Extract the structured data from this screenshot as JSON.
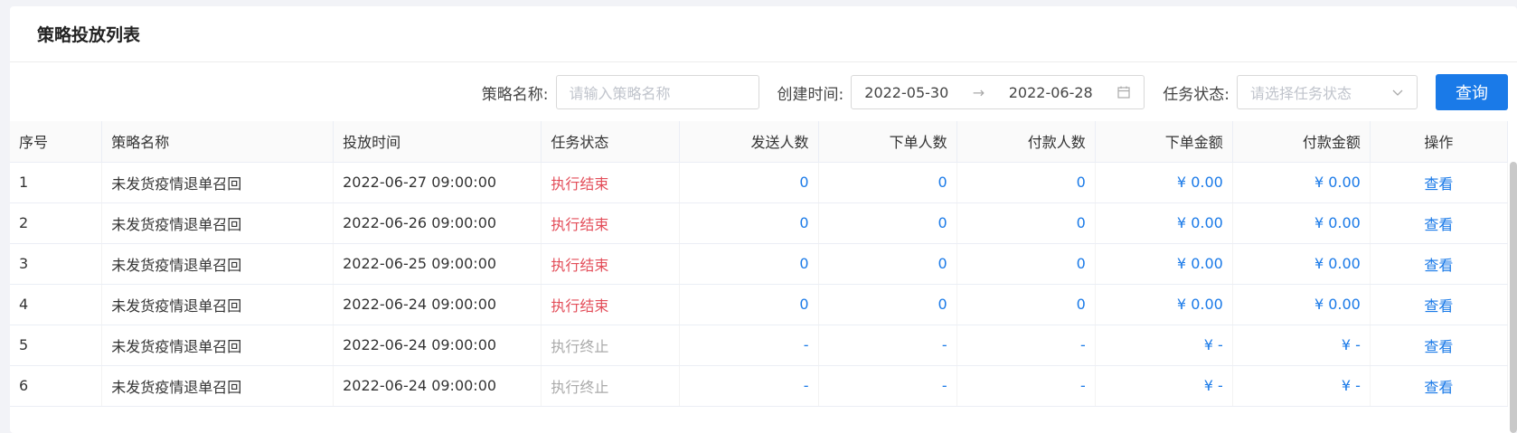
{
  "card": {
    "title": "策略投放列表"
  },
  "filters": {
    "name_label": "策略名称:",
    "name_placeholder": "请输入策略名称",
    "date_label": "创建时间:",
    "date_start": "2022-05-30",
    "date_sep": "→",
    "date_end": "2022-06-28",
    "status_label": "任务状态:",
    "status_placeholder": "请选择任务状态",
    "query_label": "查询"
  },
  "table": {
    "columns": [
      "序号",
      "策略名称",
      "投放时间",
      "任务状态",
      "发送人数",
      "下单人数",
      "付款人数",
      "下单金额",
      "付款金额",
      "操作"
    ],
    "rows": [
      [
        "1",
        "未发货疫情退单召回",
        "2022-06-27 09:00:00",
        "执行结束",
        "0",
        "0",
        "0",
        "¥ 0.00",
        "¥ 0.00",
        "查看"
      ],
      [
        "2",
        "未发货疫情退单召回",
        "2022-06-26 09:00:00",
        "执行结束",
        "0",
        "0",
        "0",
        "¥ 0.00",
        "¥ 0.00",
        "查看"
      ],
      [
        "3",
        "未发货疫情退单召回",
        "2022-06-25 09:00:00",
        "执行结束",
        "0",
        "0",
        "0",
        "¥ 0.00",
        "¥ 0.00",
        "查看"
      ],
      [
        "4",
        "未发货疫情退单召回",
        "2022-06-24 09:00:00",
        "执行结束",
        "0",
        "0",
        "0",
        "¥ 0.00",
        "¥ 0.00",
        "查看"
      ],
      [
        "5",
        "未发货疫情退单召回",
        "2022-06-24 09:00:00",
        "执行终止",
        "-",
        "-",
        "-",
        "¥ -",
        "¥ -",
        "查看"
      ],
      [
        "6",
        "未发货疫情退单召回",
        "2022-06-24 09:00:00",
        "执行终止",
        "-",
        "-",
        "-",
        "¥ -",
        "¥ -",
        "查看"
      ]
    ]
  },
  "colors": {
    "accent": "#1a7ae8",
    "status_done": "#e34d59",
    "status_stopped": "#aaaaaa"
  }
}
